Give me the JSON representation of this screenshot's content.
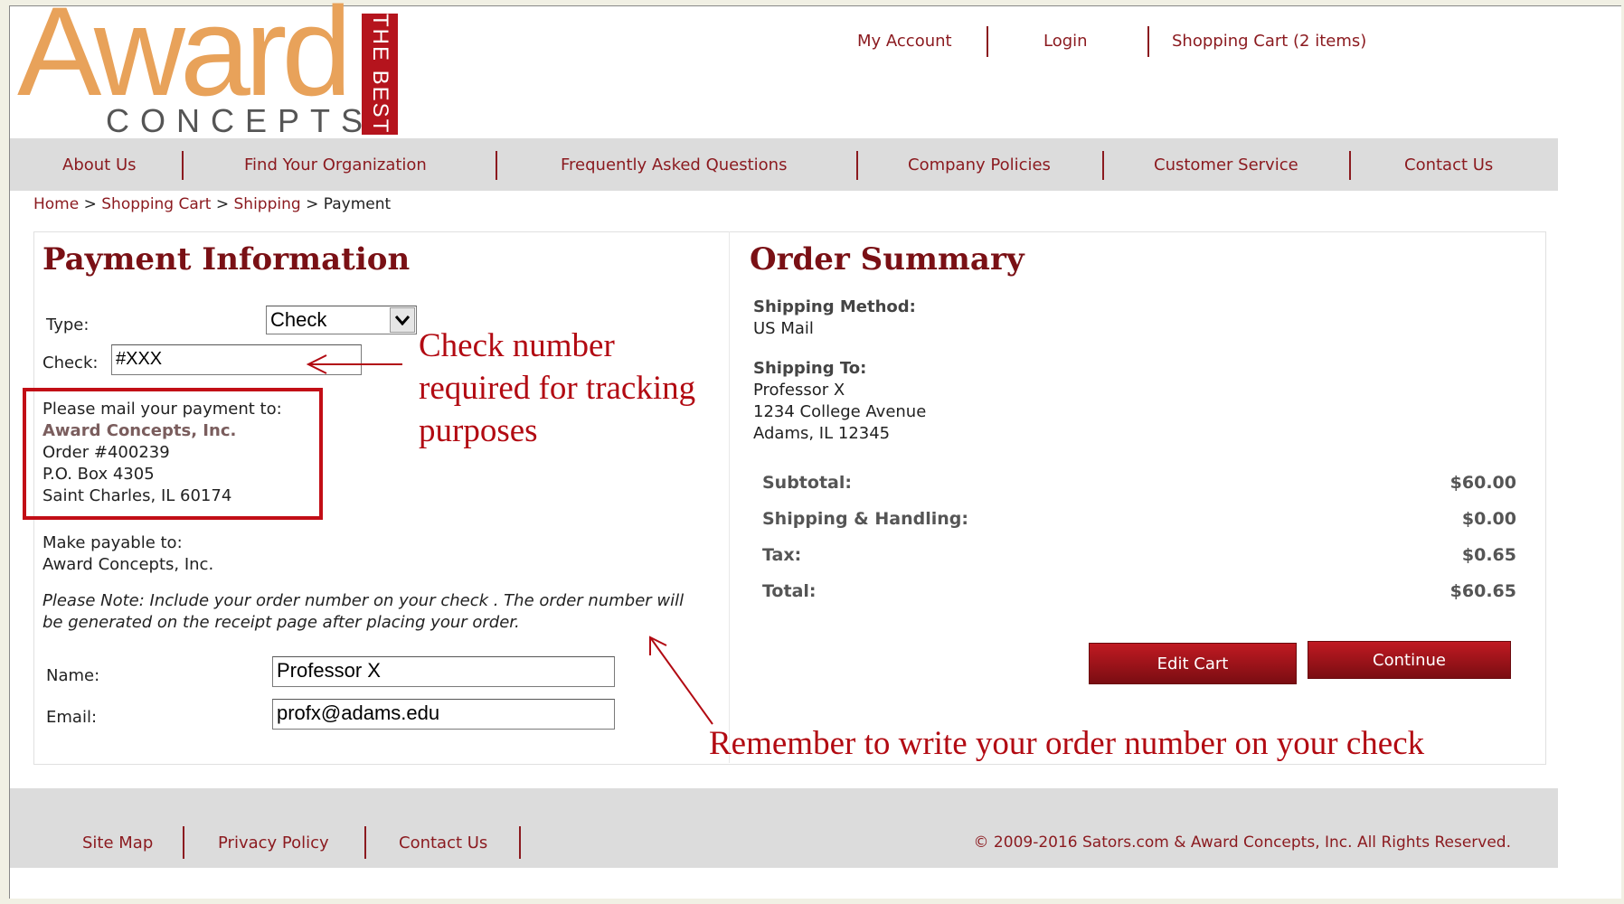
{
  "logo": {
    "award": "Award",
    "concepts": "CONCEPTS",
    "best": "THE BEST"
  },
  "top_links": {
    "account": "My Account",
    "login": "Login",
    "cart": "Shopping Cart (2 items)"
  },
  "nav": [
    "About Us",
    "Find Your Organization",
    "Frequently Asked Questions",
    "Company Policies",
    "Customer Service",
    "Contact Us"
  ],
  "breadcrumb": {
    "home": "Home",
    "cart": "Shopping Cart",
    "shipping": "Shipping",
    "current": "Payment",
    "sep": ">"
  },
  "payment": {
    "title": "Payment Information",
    "type_label": "Type:",
    "type_value": "Check",
    "check_label": "Check:",
    "check_value": "#XXX",
    "mail_intro": "Please mail your payment to:",
    "mail_company": "Award Concepts, Inc.",
    "mail_order": "Order #400239",
    "mail_box": "P.O. Box 4305",
    "mail_city": "Saint Charles, IL 60174",
    "payable_label": "Make payable to:",
    "payable_name": "Award Concepts, Inc.",
    "note": "Please Note:  Include  your order number on your check .   The order number will be generated on the  receipt page after placing your order.",
    "name_label": "Name:",
    "name_value": "Professor X",
    "email_label": "Email:",
    "email_value": "profx@adams.edu"
  },
  "summary": {
    "title": "Order Summary",
    "ship_method_label": "Shipping Method:",
    "ship_method_value": "US Mail",
    "ship_to_label": "Shipping To:",
    "ship_to_name": "Professor X",
    "ship_to_street": "1234 College Avenue",
    "ship_to_city": "Adams, IL 12345",
    "subtotal_label": "Subtotal:",
    "subtotal_value": "$60.00",
    "shipping_label": "Shipping & Handling:",
    "shipping_value": "$0.00",
    "tax_label": "Tax:",
    "tax_value": "$0.65",
    "total_label": "Total:",
    "total_value": "$60.65",
    "edit_cart": "Edit Cart",
    "continue": "Continue"
  },
  "annotations": {
    "check_line1": "Check number",
    "check_line2": "required for tracking",
    "check_line3": "purposes",
    "remember": "Remember to write your order number on your check"
  },
  "footer": {
    "sitemap": "Site Map",
    "privacy": "Privacy Policy",
    "contact": "Contact Us",
    "copyright": "© 2009-2016 Sators.com & Award Concepts, Inc. All Rights Reserved."
  },
  "colors": {
    "brand": "#8b1a1f",
    "annotation": "#b20a12",
    "logo_orange": "#e8a25a"
  },
  "icons": {
    "select_arrow": "chevron-down-icon"
  }
}
